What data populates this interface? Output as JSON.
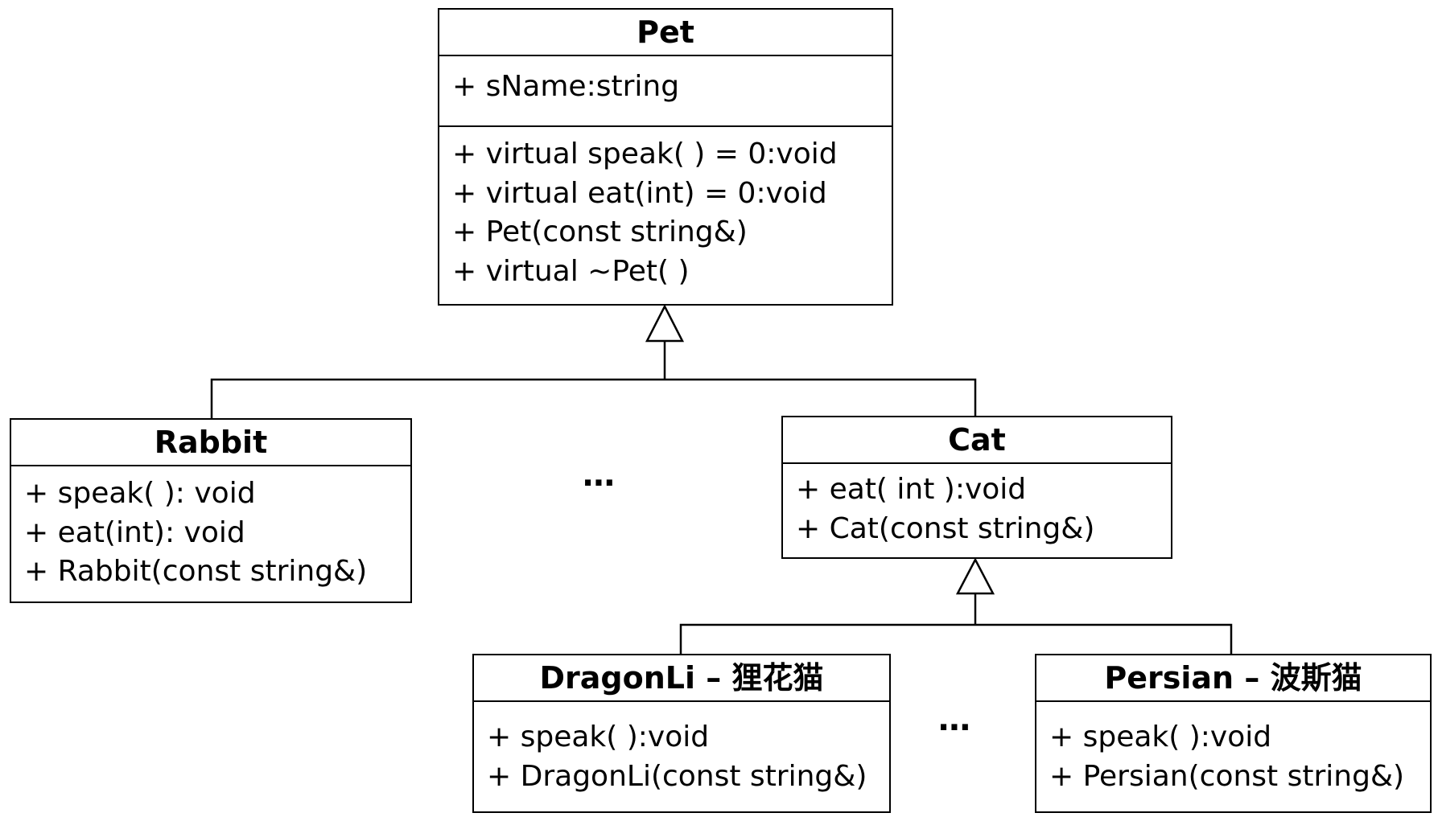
{
  "classes": {
    "pet": {
      "name": "Pet",
      "attributes": [
        "+ sName:string"
      ],
      "methods": [
        "+ virtual speak( ) = 0:void",
        "+ virtual eat(int) = 0:void",
        "+ Pet(const string&)",
        "+ virtual ~Pet( )"
      ]
    },
    "rabbit": {
      "name": "Rabbit",
      "methods": [
        "+ speak( ): void",
        "+ eat(int): void",
        "+ Rabbit(const string&)"
      ]
    },
    "cat": {
      "name": "Cat",
      "methods": [
        "+ eat( int ):void",
        "+ Cat(const string&)"
      ]
    },
    "dragonli": {
      "name": "DragonLi – 狸花猫",
      "methods": [
        "+ speak( ):void",
        "+ DragonLi(const string&)"
      ]
    },
    "persian": {
      "name": "Persian – 波斯猫",
      "methods": [
        "+ speak( ):void",
        "+ Persian(const string&)"
      ]
    }
  },
  "ellipsis": [
    "⋯",
    "⋯"
  ],
  "relations": [
    {
      "type": "inheritance",
      "from": "Rabbit",
      "to": "Pet"
    },
    {
      "type": "inheritance",
      "from": "Cat",
      "to": "Pet"
    },
    {
      "type": "inheritance",
      "from": "DragonLi – 狸花猫",
      "to": "Cat"
    },
    {
      "type": "inheritance",
      "from": "Persian – 波斯猫",
      "to": "Cat"
    }
  ]
}
